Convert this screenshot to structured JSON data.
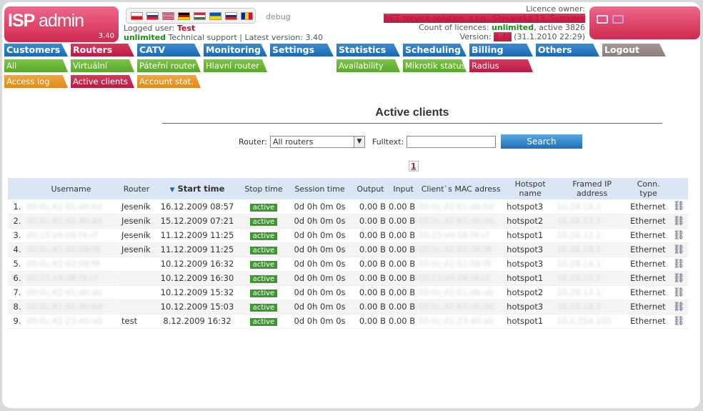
{
  "logo": {
    "isp": "ISP",
    "admin": "admin",
    "version": "3.40"
  },
  "header": {
    "debug": "debug",
    "logged_label": "Logged user:",
    "user": "Test",
    "unlimited": "unlimited",
    "support": "Technical support | Latest version: 3.40"
  },
  "licence": {
    "owner_label": "Licence owner:",
    "owner": "NET service solution, s.r.o., Slovanská 13, Šumperk",
    "count_label": "Count of licences:",
    "count": "unlimited",
    "active": ", active 3826",
    "version_label": "Version:",
    "version": "3.40",
    "version_date": "(31.1.2010 22:29)"
  },
  "menu": {
    "main": [
      "Customers",
      "Routers",
      "CATV",
      "Monitoring",
      "Settings",
      "Statistics",
      "Scheduling",
      "Billing",
      "Others",
      "Logout"
    ],
    "sub1": [
      "All",
      "Virtuální router",
      "Páteřní router",
      "Hlavní router",
      "Availability",
      "Mikrotik status",
      "Radius"
    ],
    "sub2": [
      "Access log",
      "Active clients",
      "Account stat."
    ]
  },
  "page": {
    "title": "Active clients",
    "router_label": "Router:",
    "router_value": "All routers",
    "fulltext_label": "Fulltext:",
    "search": "Search",
    "page": "1"
  },
  "table": {
    "headers": [
      "Username",
      "Router",
      "Start time",
      "Stop time",
      "Session time",
      "Output",
      "Input",
      "Client`s MAC adress",
      "Hotspot name",
      "Framed IP address",
      "Conn. type"
    ],
    "rows": [
      {
        "n": "1.",
        "user": "00:0c:42:61:db:bd",
        "router": "Jeseník",
        "start": "16.12.2009 08:57",
        "stop": "active",
        "session": "0d 0h 0m 0s",
        "out": "0.00 B",
        "in": "0.00 B",
        "mac": "00:0c:42:61:db:bd",
        "hotspot": "hotspot3",
        "ip": "10.24.14.2",
        "conn": "Ethernet"
      },
      {
        "n": "2.",
        "user": "00:0c:42:61:db:ab",
        "router": "Jeseník",
        "start": "15.12.2009 07:21",
        "stop": "active",
        "session": "0d 0h 0m 0s",
        "out": "0.00 B",
        "in": "0.00 B",
        "mac": "00:0c:42:61:db:ab",
        "hotspot": "hotspot2",
        "ip": "10.24.13.1",
        "conn": "Ethernet"
      },
      {
        "n": "3.",
        "user": "00:15:e9:08:f4:cf",
        "router": "Jeseník",
        "start": "11.12.2009 11:25",
        "stop": "active",
        "session": "0d 0h 0m 0s",
        "out": "0.00 B",
        "in": "0.00 B",
        "mac": "00:15:e9:08:f4:cf",
        "hotspot": "hotspot1",
        "ip": "10.24.12.1",
        "conn": "Ethernet"
      },
      {
        "n": "4.",
        "user": "00:0c:42:62:08:f8",
        "router": "Jeseník",
        "start": "11.12.2009 11:25",
        "stop": "active",
        "session": "0d 0h 0m 0s",
        "out": "0.00 B",
        "in": "0.00 B",
        "mac": "00:0c:42:62:08:f8",
        "hotspot": "hotspot3",
        "ip": "10.24.14.1",
        "conn": "Ethernet"
      },
      {
        "n": "5.",
        "user": "00:0c:42:62:08:f8",
        "router": "",
        "start": "10.12.2009 16:32",
        "stop": "active",
        "session": "0d 0h 0m 0s",
        "out": "0.00 B",
        "in": "0.00 B",
        "mac": "00:0c:42:62:08:f8",
        "hotspot": "hotspot3",
        "ip": "10.28.14.1",
        "conn": "Ethernet"
      },
      {
        "n": "6.",
        "user": "00:15:e9:08:f4:cf",
        "router": "",
        "start": "10.12.2009 16:30",
        "stop": "active",
        "session": "0d 0h 0m 0s",
        "out": "0.00 B",
        "in": "0.00 B",
        "mac": "00:15:e9:08:f4:cf",
        "hotspot": "hotspot1",
        "ip": "10.28.12.1",
        "conn": "Ethernet"
      },
      {
        "n": "7.",
        "user": "00:0c:42:61:db:ab",
        "router": "",
        "start": "10.12.2009 15:32",
        "stop": "active",
        "session": "0d 0h 0m 0s",
        "out": "0.00 B",
        "in": "0.00 B",
        "mac": "00:0c:42:61:db:ab",
        "hotspot": "hotspot2",
        "ip": "10.28.13.1",
        "conn": "Ethernet"
      },
      {
        "n": "8.",
        "user": "00:0c:42:61:db:bd",
        "router": "",
        "start": "10.12.2009 15:03",
        "stop": "active",
        "session": "0d 0h 0m 0s",
        "out": "0.00 B",
        "in": "0.00 B",
        "mac": "00:0c:42:61:db:bd",
        "hotspot": "hotspot3",
        "ip": "10.28.14.2",
        "conn": "Ethernet"
      },
      {
        "n": "9.",
        "user": "00:0c:42:23:40:a0",
        "router": "test",
        "start": "8.12.2009 16:32",
        "stop": "active",
        "session": "0d 0h 0m 0s",
        "out": "0.00 B",
        "in": "0.00 B",
        "mac": "00:0c:42:23:40:a0",
        "hotspot": "hotspot1",
        "ip": "10.0.254.100",
        "conn": "Ethernet"
      }
    ]
  },
  "colors": {
    "brand": "#d8385e",
    "menu_blue": "#1a6ab3",
    "sub_green": "#5aa82c",
    "sub_orange": "#de8a1c"
  }
}
